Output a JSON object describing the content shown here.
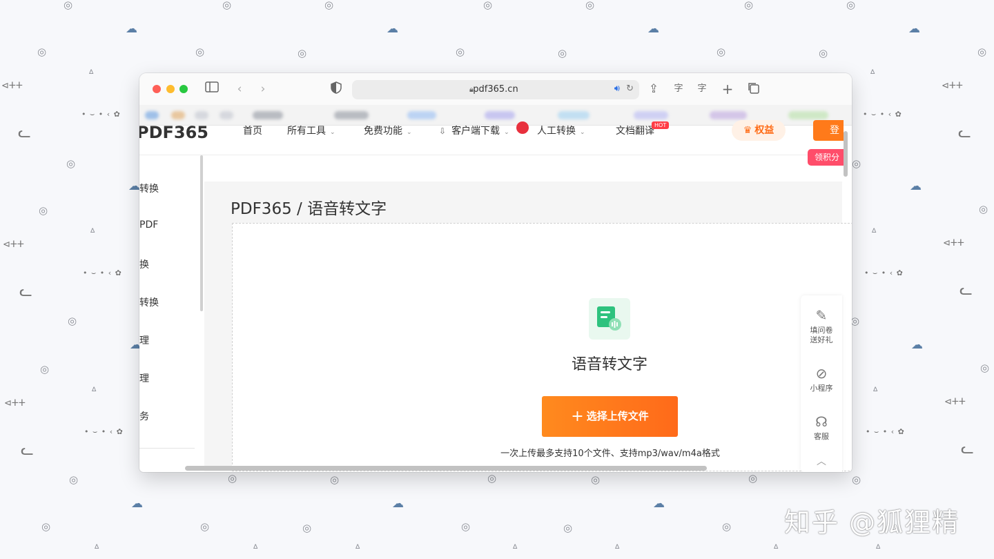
{
  "browser": {
    "url": "pdf365.cn"
  },
  "site": {
    "logo": "PDF365",
    "nav": [
      {
        "label": "首页",
        "caret": ""
      },
      {
        "label": "所有工具",
        "caret": "⌄"
      },
      {
        "label": "免费功能",
        "caret": "⌄"
      },
      {
        "label": "客户端下载",
        "caret": "⌄"
      },
      {
        "label": "人工转换",
        "caret": "⌄"
      },
      {
        "label": "文档翻译",
        "caret": ""
      }
    ],
    "benefits_label": "权益",
    "login_label": "登",
    "points_label": "领积分"
  },
  "sidebar": {
    "items": [
      "转换",
      "PDF",
      "换",
      "转换",
      "理",
      "理",
      "务"
    ]
  },
  "main": {
    "breadcrumb": "PDF365 / 语音转文字",
    "tool_title": "语音转文字",
    "upload_button": "选择上传文件",
    "upload_hint": "一次上传最多支持10个文件、支持mp3/wav/m4a格式"
  },
  "float_bar": {
    "survey_line1": "填问卷",
    "survey_line2": "送好礼",
    "mini_program": "小程序",
    "service": "客服"
  },
  "watermark": "知乎 @狐狸精",
  "colors": {
    "accent": "#ff7a1a",
    "points_pill": "#ff4d6a",
    "icon_green": "#2ec27e"
  }
}
